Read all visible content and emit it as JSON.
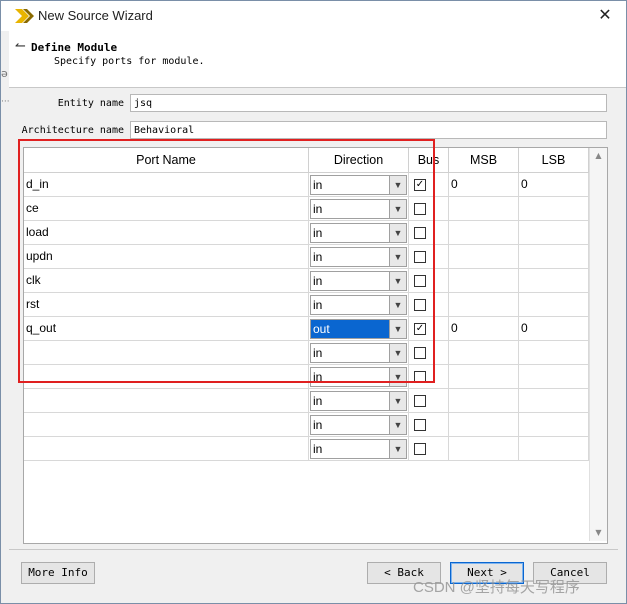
{
  "window": {
    "title": "New Source Wizard",
    "close_glyph": "✕"
  },
  "header": {
    "back_glyph": "↼",
    "title": "Define Module",
    "subtitle": "Specify ports for module."
  },
  "fields": {
    "entity_label": "Entity name",
    "entity_value": "jsq",
    "arch_label": "Architecture name",
    "arch_value": "Behavioral"
  },
  "table": {
    "columns": [
      "Port Name",
      "Direction",
      "Bus",
      "MSB",
      "LSB"
    ],
    "rows": [
      {
        "port": "d_in",
        "direction": "in",
        "bus": true,
        "msb": "0",
        "lsb": "0"
      },
      {
        "port": "ce",
        "direction": "in",
        "bus": false,
        "msb": "",
        "lsb": ""
      },
      {
        "port": "load",
        "direction": "in",
        "bus": false,
        "msb": "",
        "lsb": ""
      },
      {
        "port": "updn",
        "direction": "in",
        "bus": false,
        "msb": "",
        "lsb": ""
      },
      {
        "port": "clk",
        "direction": "in",
        "bus": false,
        "msb": "",
        "lsb": ""
      },
      {
        "port": "rst",
        "direction": "in",
        "bus": false,
        "msb": "",
        "lsb": ""
      },
      {
        "port": "q_out",
        "direction": "out",
        "bus": true,
        "msb": "0",
        "lsb": "0",
        "selected": true
      },
      {
        "port": "",
        "direction": "in",
        "bus": false,
        "msb": "",
        "lsb": ""
      },
      {
        "port": "",
        "direction": "in",
        "bus": false,
        "msb": "",
        "lsb": ""
      },
      {
        "port": "",
        "direction": "in",
        "bus": false,
        "msb": "",
        "lsb": ""
      },
      {
        "port": "",
        "direction": "in",
        "bus": false,
        "msb": "",
        "lsb": ""
      },
      {
        "port": "",
        "direction": "in",
        "bus": false,
        "msb": "",
        "lsb": ""
      }
    ]
  },
  "buttons": {
    "more_info": "More Info",
    "back": "< Back",
    "next": "Next >",
    "cancel": "Cancel"
  },
  "watermark": "CSDN @坚持每天写程序",
  "colors": {
    "highlight_box": "#e02020",
    "selected_cell": "#0a66d0",
    "logo_yellow": "#e8b400"
  }
}
